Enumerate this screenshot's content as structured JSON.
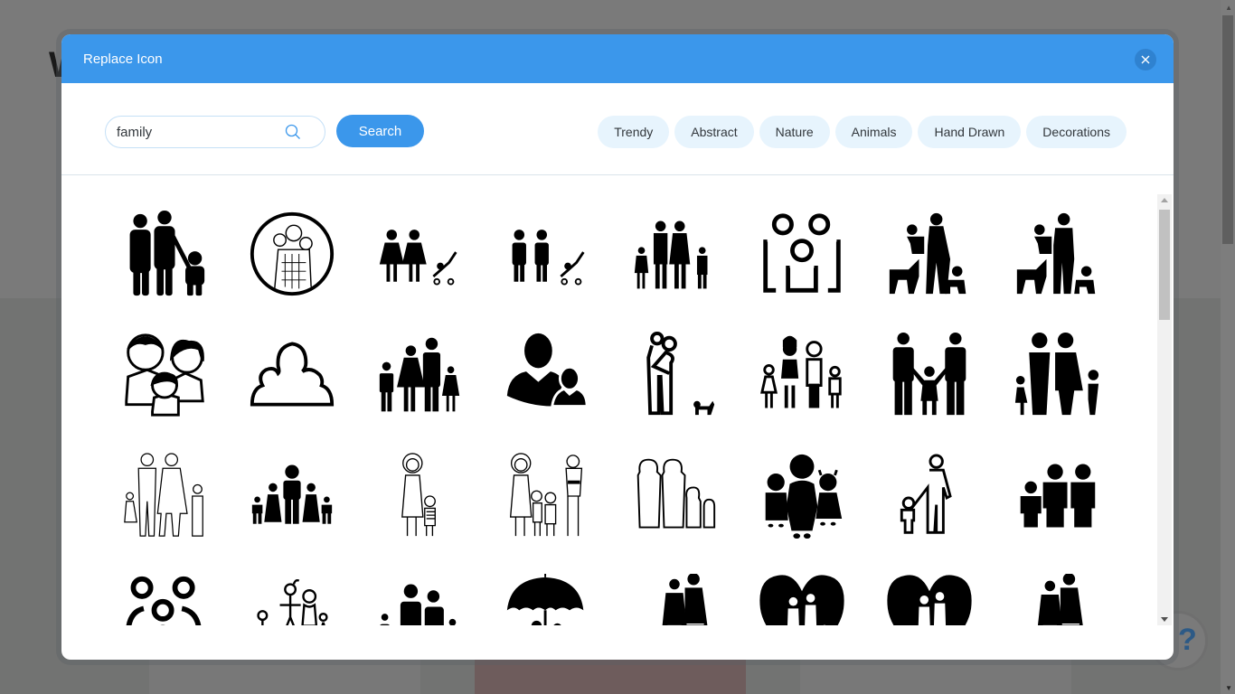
{
  "modal": {
    "title": "Replace Icon",
    "close_label": "×"
  },
  "search": {
    "value": "family",
    "placeholder": "Search",
    "button_label": "Search"
  },
  "categories": [
    "Trendy",
    "Abstract",
    "Nature",
    "Animals",
    "Hand Drawn",
    "Decorations"
  ],
  "icons": [
    {
      "name": "family-parents-child-solid"
    },
    {
      "name": "family-sketch-circle"
    },
    {
      "name": "two-women-stroller"
    },
    {
      "name": "two-men-stroller"
    },
    {
      "name": "family-four-holding-hands"
    },
    {
      "name": "family-outline-rounded"
    },
    {
      "name": "mother-baby-dog-child"
    },
    {
      "name": "father-baby-dog-child"
    },
    {
      "name": "cartoon-family-smiling"
    },
    {
      "name": "family-outline-cloud"
    },
    {
      "name": "family-four-pictogram"
    },
    {
      "name": "parent-child-user"
    },
    {
      "name": "couple-hug-dog-outline"
    },
    {
      "name": "family-four-mixed"
    },
    {
      "name": "two-parents-child-middle"
    },
    {
      "name": "family-four-block"
    },
    {
      "name": "family-thin-outline"
    },
    {
      "name": "family-five-small"
    },
    {
      "name": "mother-daughter-sketch"
    },
    {
      "name": "family-four-sketch"
    },
    {
      "name": "family-outline-rounded-four"
    },
    {
      "name": "family-three-kids-silhouette"
    },
    {
      "name": "father-child-outline"
    },
    {
      "name": "family-three-solid"
    },
    {
      "name": "family-rings-outline"
    },
    {
      "name": "family-stick-drawing"
    },
    {
      "name": "family-four-rounded"
    },
    {
      "name": "family-under-umbrella"
    },
    {
      "name": "family-walking-silhouette"
    },
    {
      "name": "family-heart-black"
    },
    {
      "name": "family-heart-black-alt"
    },
    {
      "name": "family-walking-silhouette-alt"
    }
  ],
  "background": {
    "letter": "W",
    "help_label": "?"
  }
}
